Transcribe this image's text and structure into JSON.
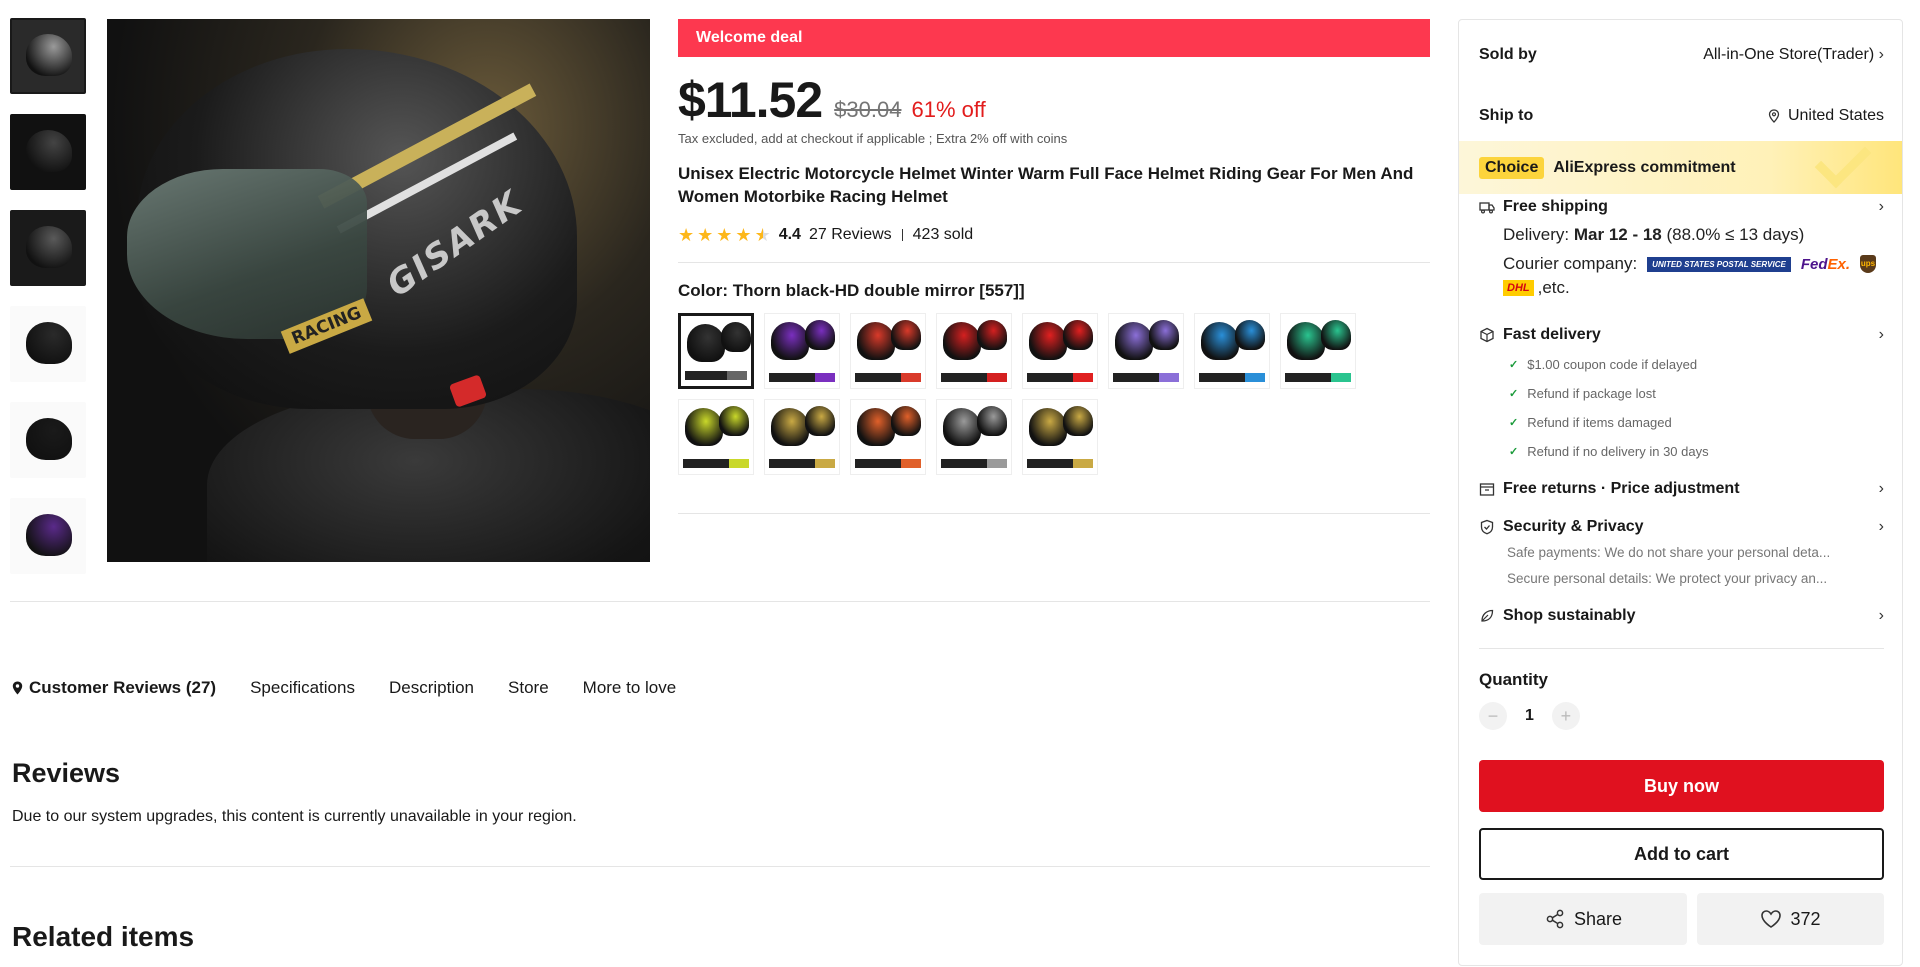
{
  "thumbnails": [
    {
      "colors": [
        "#2a2a2a",
        "#9a9a9a"
      ],
      "active": true
    },
    {
      "colors": [
        "#111",
        "#444"
      ],
      "active": false
    },
    {
      "colors": [
        "#1a1a1a",
        "#5a5a5a"
      ],
      "active": false
    },
    {
      "colors": [
        "#fafafa",
        "#2a2a2a"
      ],
      "active": false
    },
    {
      "colors": [
        "#fafafa",
        "#1a1a1a"
      ],
      "active": false
    },
    {
      "colors": [
        "#fafafa",
        "#5a2a8a"
      ],
      "active": false
    }
  ],
  "product": {
    "welcome_deal": "Welcome deal",
    "price": "$11.52",
    "original_price": "$30.04",
    "discount": "61% off",
    "tax_note": "Tax excluded, add at checkout if applicable ; Extra 2% off with coins",
    "title": "Unisex Electric Motorcycle Helmet Winter Warm Full Face Helmet Riding Gear For Men And Women Motorbike Racing Helmet",
    "rating": "4.4",
    "rating_value": 4.4,
    "reviews": "27 Reviews",
    "sold": "423 sold",
    "color_label": "Color: Thorn black-HD double mirror [557]]",
    "image_brand_text": "GISARK",
    "image_racing_text": "RACING",
    "colors": [
      {
        "accent": "#333333",
        "tag": "#666666",
        "active": true
      },
      {
        "accent": "#7a2fbf",
        "tag": "#7a2fbf",
        "active": false
      },
      {
        "accent": "#d93a2a",
        "tag": "#d93a2a",
        "active": false
      },
      {
        "accent": "#d42020",
        "tag": "#d42020",
        "active": false
      },
      {
        "accent": "#e02020",
        "tag": "#e02020",
        "active": false
      },
      {
        "accent": "#8b6fd8",
        "tag": "#8b6fd8",
        "active": false
      },
      {
        "accent": "#2a8fd8",
        "tag": "#2a8fd8",
        "active": false
      },
      {
        "accent": "#2ac48f",
        "tag": "#2ac48f",
        "active": false
      },
      {
        "accent": "#c9d82a",
        "tag": "#c9d82a",
        "active": false
      },
      {
        "accent": "#c9a944",
        "tag": "#c9a944",
        "active": false
      },
      {
        "accent": "#e0602a",
        "tag": "#e0602a",
        "active": false
      },
      {
        "accent": "#9a9a9a",
        "tag": "#9a9a9a",
        "active": false
      },
      {
        "accent": "#c9a944",
        "tag": "#c9a944",
        "active": false
      }
    ]
  },
  "tabs": [
    {
      "label": "Customer Reviews (27)",
      "active": true
    },
    {
      "label": "Specifications",
      "active": false
    },
    {
      "label": "Description",
      "active": false
    },
    {
      "label": "Store",
      "active": false
    },
    {
      "label": "More to love",
      "active": false
    }
  ],
  "reviews": {
    "heading": "Reviews",
    "message": "Due to our system upgrades, this content is currently unavailable in your region."
  },
  "related": {
    "heading": "Related items"
  },
  "panel": {
    "sold_by_label": "Sold by",
    "sold_by_value": "All-in-One Store(Trader)",
    "ship_to_label": "Ship to",
    "ship_to_value": "United States",
    "choice_badge": "Choice",
    "choice_text": "AliExpress commitment",
    "free_shipping": "Free shipping",
    "delivery_label": "Delivery:",
    "delivery_dates": "Mar 12 - 18",
    "delivery_rate": "(88.0% ≤ 13 days)",
    "courier_label": "Courier company:",
    "usps_text": "UNITED STATES POSTAL SERVICE",
    "fedex_fed": "Fed",
    "fedex_ex": "Ex.",
    "ups_text": "ups",
    "dhl_text": "DHL",
    "etc": ",etc.",
    "fast_delivery": "Fast delivery",
    "fast_items": [
      "$1.00 coupon code if delayed",
      "Refund if package lost",
      "Refund if items damaged",
      "Refund if no delivery in 30 days"
    ],
    "free_returns": "Free returns · Price adjustment",
    "security": "Security & Privacy",
    "security_lines": [
      "Safe payments: We do not share your personal deta...",
      "Secure personal details: We protect your privacy an..."
    ],
    "sustainably": "Shop sustainably",
    "quantity_label": "Quantity",
    "quantity_value": "1",
    "minus": "−",
    "plus": "+",
    "buy_now": "Buy now",
    "add_to_cart": "Add to cart",
    "share": "Share",
    "wishlist_count": "372"
  }
}
